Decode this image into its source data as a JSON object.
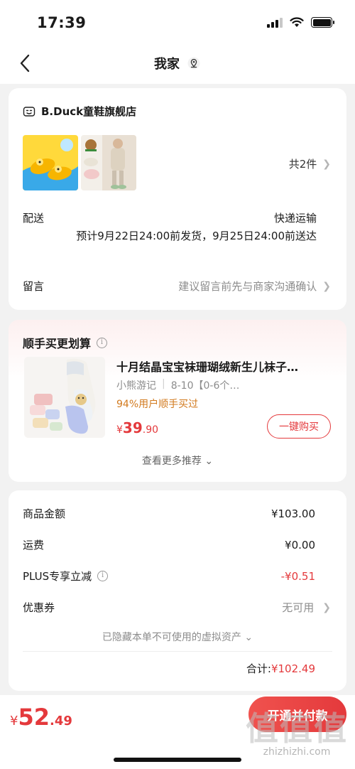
{
  "status_bar": {
    "time": "17:39"
  },
  "nav": {
    "title": "我家"
  },
  "store": {
    "name": "B.Duck童鞋旗舰店",
    "item_count": "共2件",
    "delivery_label": "配送",
    "delivery_method": "快递运输",
    "delivery_note": "预计9月22日24:00前发货，9月25日24:00前送达",
    "memo_label": "留言",
    "memo_hint": "建议留言前先与商家沟通确认"
  },
  "recommend": {
    "title": "顺手买更划算",
    "product_name": "十月结晶宝宝袜珊瑚绒新生儿袜子…",
    "brand": "小熊游记",
    "spec": "8-10【0-6个…",
    "ratio_text": "94%用户顺手买过",
    "price_symbol": "¥",
    "price_int": "39",
    "price_dec": ".90",
    "buy_label": "一键购买",
    "more_label": "查看更多推荐 ⌄"
  },
  "summary": {
    "goods_label": "商品金额",
    "goods_value": "¥103.00",
    "shipping_label": "运费",
    "shipping_value": "¥0.00",
    "plus_label": "PLUS专享立减",
    "plus_value": "-¥0.51",
    "coupon_label": "优惠券",
    "coupon_value": "无可用",
    "hidden_note": "已隐藏本单不可使用的虚拟资产 ⌄",
    "total_label": "合计:",
    "total_value": "¥102.49"
  },
  "bottom": {
    "pay_symbol": "¥",
    "pay_int": "52",
    "pay_dec": ".49",
    "pay_button": "开通并付款"
  },
  "watermark": {
    "logo": "值值值",
    "url": "zhizhizhi.com"
  },
  "colors": {
    "accent": "#e4393c",
    "ratio": "#d27a1e",
    "muted": "#8c8c8c",
    "background": "#f2f2f2"
  }
}
